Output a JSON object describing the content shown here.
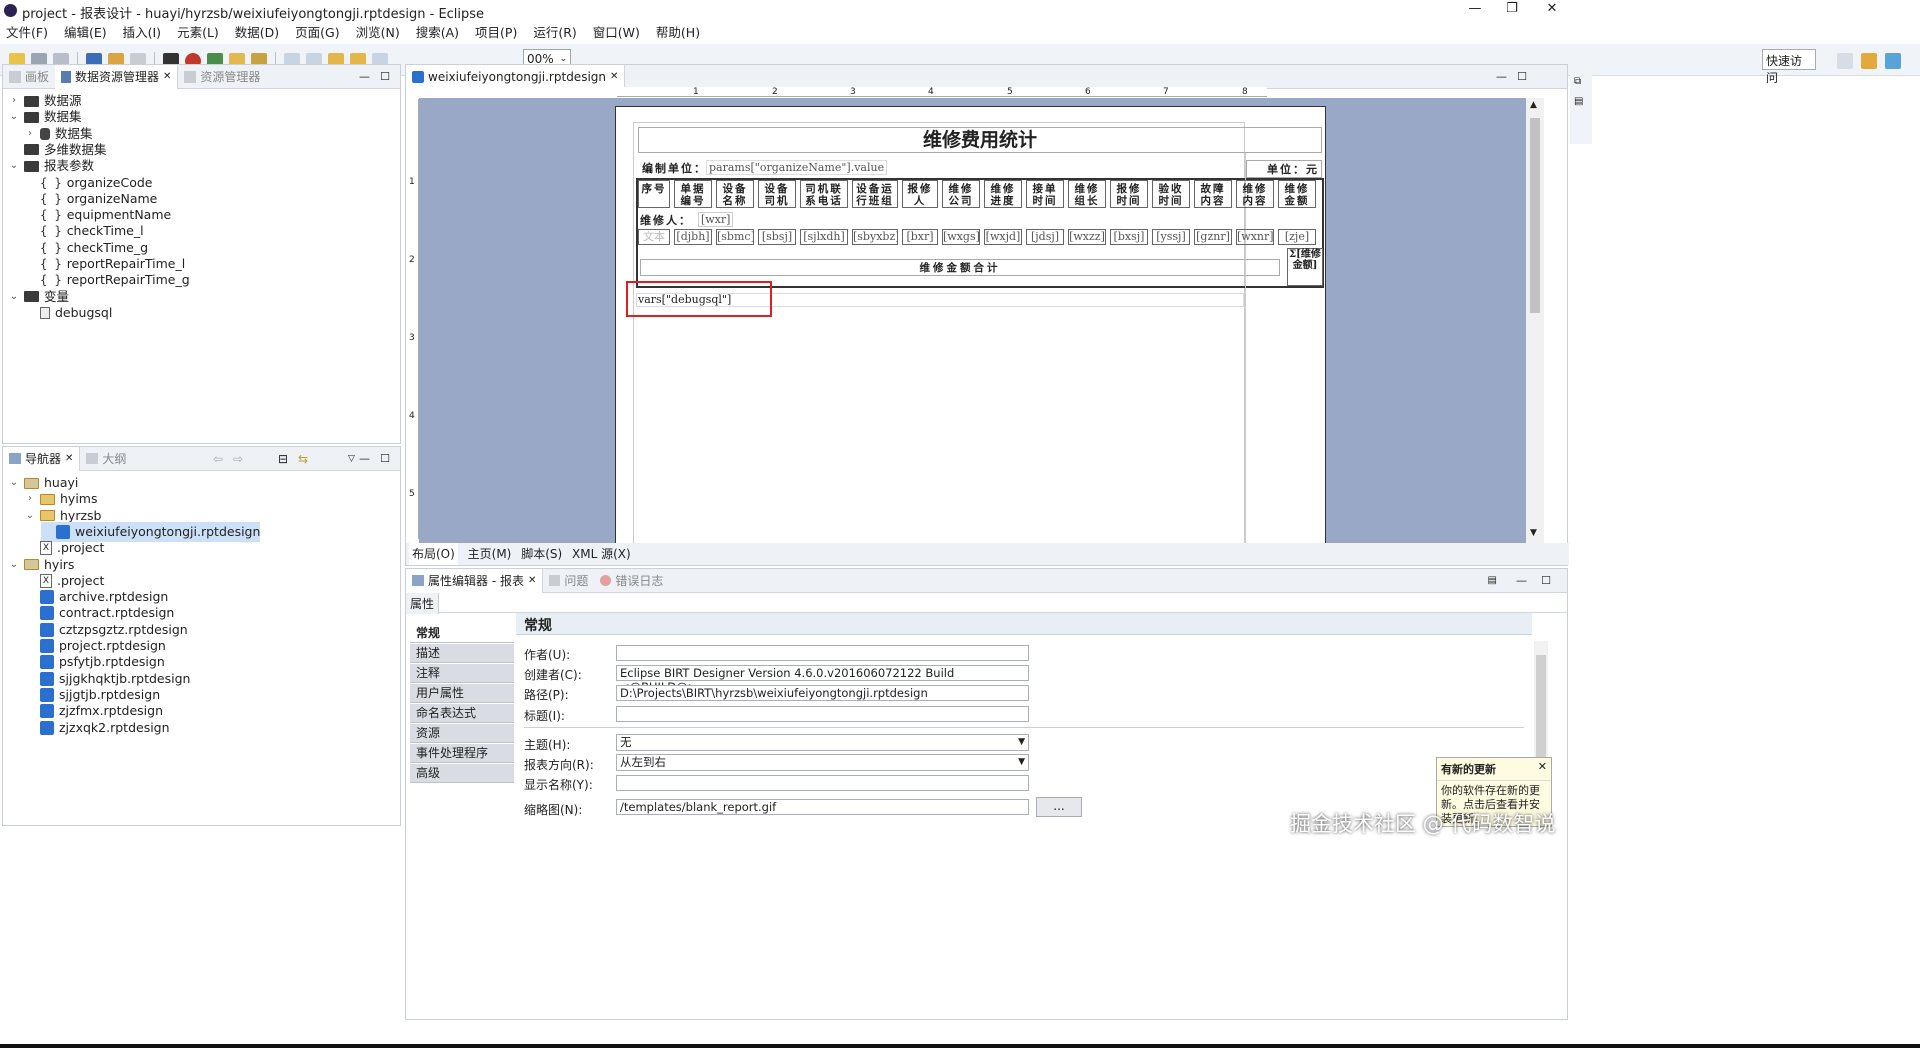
{
  "window": {
    "title": "project - 报表设计 - huayi/hyrzsb/weixiufeiyongtongji.rptdesign - Eclipse"
  },
  "menu": [
    "文件(F)",
    "编辑(E)",
    "插入(I)",
    "元素(L)",
    "数据(D)",
    "页面(G)",
    "浏览(N)",
    "搜索(A)",
    "项目(P)",
    "运行(R)",
    "窗口(W)",
    "帮助(H)"
  ],
  "toolbar": {
    "zoom": "00%",
    "quick_access": "快速访问"
  },
  "data_explorer": {
    "tabs": [
      "画板",
      "数据资源管理器",
      "资源管理器"
    ],
    "items": [
      {
        "label": "数据源",
        "level": 0,
        "expanded": false,
        "type": "folder"
      },
      {
        "label": "数据集",
        "level": 0,
        "expanded": true,
        "type": "folder"
      },
      {
        "label": "数据集",
        "level": 1,
        "expanded": false,
        "type": "dataset"
      },
      {
        "label": "多维数据集",
        "level": 0,
        "type": "folder"
      },
      {
        "label": "报表参数",
        "level": 0,
        "expanded": true,
        "type": "folder"
      },
      {
        "label": "organizeCode",
        "level": 1,
        "type": "param"
      },
      {
        "label": "organizeName",
        "level": 1,
        "type": "param"
      },
      {
        "label": "equipmentName",
        "level": 1,
        "type": "param"
      },
      {
        "label": "checkTime_l",
        "level": 1,
        "type": "param"
      },
      {
        "label": "checkTime_g",
        "level": 1,
        "type": "param"
      },
      {
        "label": "reportRepairTime_l",
        "level": 1,
        "type": "param"
      },
      {
        "label": "reportRepairTime_g",
        "level": 1,
        "type": "param"
      },
      {
        "label": "变量",
        "level": 0,
        "expanded": true,
        "type": "folder"
      },
      {
        "label": "debugsql",
        "level": 1,
        "type": "var"
      }
    ]
  },
  "navigator": {
    "tabs": [
      "导航器",
      "大纲"
    ],
    "items": [
      {
        "label": "huayi",
        "level": 0,
        "expanded": true,
        "type": "project"
      },
      {
        "label": "hyims",
        "level": 1,
        "expanded": false,
        "type": "folder"
      },
      {
        "label": "hyrzsb",
        "level": 1,
        "expanded": true,
        "type": "folder"
      },
      {
        "label": "weixiufeiyongtongji.rptdesign",
        "level": 2,
        "type": "rpt",
        "selected": true
      },
      {
        "label": ".project",
        "level": 1,
        "type": "x"
      },
      {
        "label": "hyirs",
        "level": 0,
        "expanded": true,
        "type": "project"
      },
      {
        "label": ".project",
        "level": 1,
        "type": "x"
      },
      {
        "label": "archive.rptdesign",
        "level": 1,
        "type": "rpt"
      },
      {
        "label": "contract.rptdesign",
        "level": 1,
        "type": "rpt"
      },
      {
        "label": "cztzpsgztz.rptdesign",
        "level": 1,
        "type": "rpt"
      },
      {
        "label": "project.rptdesign",
        "level": 1,
        "type": "rpt"
      },
      {
        "label": "psfytjb.rptdesign",
        "level": 1,
        "type": "rpt"
      },
      {
        "label": "sjjgkhqktjb.rptdesign",
        "level": 1,
        "type": "rpt"
      },
      {
        "label": "sjjgtjb.rptdesign",
        "level": 1,
        "type": "rpt"
      },
      {
        "label": "zjzfmx.rptdesign",
        "level": 1,
        "type": "rpt"
      },
      {
        "label": "zjzxqk2.rptdesign",
        "level": 1,
        "type": "rpt"
      }
    ]
  },
  "editor": {
    "tab": "weixiufeiyongtongji.rptdesign",
    "ruler": [
      "1",
      "2",
      "3",
      "4",
      "5",
      "6",
      "7",
      "8"
    ],
    "vruler": [
      "1",
      "2",
      "3",
      "4",
      "5"
    ],
    "bottom_tabs": [
      "布局(O)",
      "主页(M)",
      "脚本(S)",
      "XML 源(X)"
    ],
    "report": {
      "title": "维修费用统计",
      "unit_label": "编制单位：",
      "unit_value": "params[\"organizeName\"].value",
      "unit_right": "单位：元",
      "headers": [
        "序号",
        "单据\n编号",
        "设备\n名称",
        "设备\n司机",
        "司机联\n系电话",
        "设备运\n行班组",
        "报修\n人",
        "维修\n公司",
        "维修\n进度",
        "接单\n时间",
        "维修\n组长",
        "报修\n时间",
        "验收\n时间",
        "故障\n内容",
        "维修\n内容",
        "维修\n金额"
      ],
      "repairer_label": "维修人：",
      "repairer_value": "[wxr]",
      "data_cells": [
        "文本",
        "[djbh]",
        "[sbmc]",
        "[sbsj]",
        "[sjlxdh]",
        "[sbyxbz]",
        "[bxr]",
        "[wxgs]",
        "[wxjd]",
        "[jdsj]",
        "[wxzz]",
        "[bxsj]",
        "[yssj]",
        "[gznr]",
        "[wxnr]",
        "[zje]"
      ],
      "total_label": "维修金额合计",
      "total_value": "Σ[维修金额]",
      "debug": "vars[\"debugsql\"]"
    }
  },
  "properties": {
    "tabs": [
      "属性编辑器 - 报表",
      "问题",
      "错误日志"
    ],
    "sub_tab": "属性",
    "sections": [
      "常规",
      "描述",
      "注释",
      "用户属性",
      "命名表达式",
      "资源",
      "事件处理程序",
      "高级"
    ],
    "heading": "常规",
    "fields": {
      "author_label": "作者(U):",
      "author_value": "",
      "creator_label": "创建者(C):",
      "creator_value": "Eclipse BIRT Designer Version 4.6.0.v201606072122 Build <@BUILD@>",
      "path_label": "路径(P):",
      "path_value": "D:\\Projects\\BIRT\\hyrzsb\\weixiufeiyongtongji.rptdesign",
      "title_label": "标题(I):",
      "title_value": "",
      "theme_label": "主题(H):",
      "theme_value": "无",
      "dir_label": "报表方向(R):",
      "dir_value": "从左到右",
      "display_label": "显示名称(Y):",
      "display_value": "",
      "thumb_label": "缩略图(N):",
      "thumb_value": "/templates/blank_report.gif",
      "browse": "..."
    }
  },
  "notification": {
    "title": "有新的更新",
    "body": "你的软件存在新的更新。点击后查看并安装更新。",
    "action": "设置"
  },
  "watermark": "掘金技术社区 @ 代码数智说"
}
